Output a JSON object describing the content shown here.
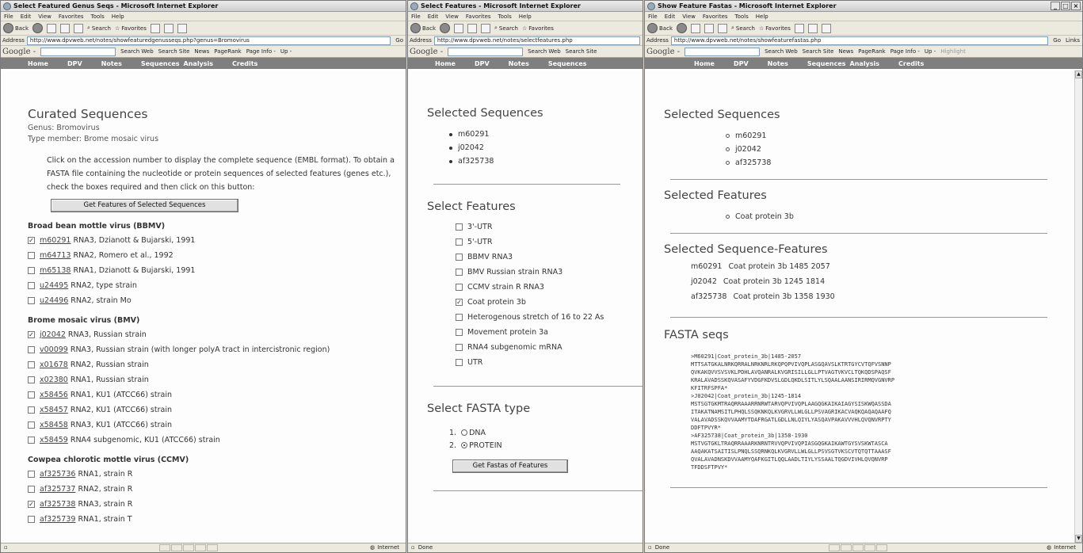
{
  "browser": {
    "menu": [
      "File",
      "Edit",
      "View",
      "Favorites",
      "Tools",
      "Help"
    ],
    "toolbar": {
      "back": "Back",
      "search": "Search",
      "favorites": "Favorites"
    },
    "address_label": "Address",
    "go_label": "Go",
    "links_label": "Links",
    "google": {
      "logo": "Google -",
      "search_web": "Search Web",
      "search_site": "Search Site",
      "news": "News",
      "pagerank": "PageRank",
      "page_info": "Page Info -",
      "up": "Up -",
      "highlight": "Highlight"
    },
    "site_nav": [
      "Home",
      "DPV",
      "Notes",
      "Sequences",
      "Analysis",
      "Credits"
    ],
    "status_done": "Done",
    "status_zone": "Internet"
  },
  "window1": {
    "title": "Select Featured Genus Seqs - Microsoft Internet Explorer",
    "url": "http://www.dpvweb.net/notes/showfeaturedgenusseqs.php?genus=Bromovirus",
    "heading": "Curated Sequences",
    "genus": "Genus: Bromovirus",
    "type_member": "Type member: Brome mosaic virus",
    "instructions": "Click on the accession number to display the complete sequence (EMBL format). To obtain a FASTA file containing the nucleotide or protein sequences of selected features (genes etc.), check the boxes required and then click on this button:",
    "button": "Get Features of Selected Sequences",
    "groups": [
      {
        "name": "Broad bean mottle virus (BBMV)",
        "rows": [
          {
            "acc": "m60291",
            "desc": "RNA3, Dzianott & Bujarski, 1991",
            "checked": true
          },
          {
            "acc": "m64713",
            "desc": "RNA2, Romero et al., 1992",
            "checked": false
          },
          {
            "acc": "m65138",
            "desc": "RNA1, Dzianott & Bujarski, 1991",
            "checked": false
          },
          {
            "acc": "u24495",
            "desc": "RNA2, type strain",
            "checked": false
          },
          {
            "acc": "u24496",
            "desc": "RNA2, strain Mo",
            "checked": false
          }
        ]
      },
      {
        "name": "Brome mosaic virus (BMV)",
        "rows": [
          {
            "acc": "j02042",
            "desc": "RNA3, Russian strain",
            "checked": true
          },
          {
            "acc": "v00099",
            "desc": "RNA3, Russian strain (with longer polyA tract in intercistronic region)",
            "checked": false
          },
          {
            "acc": "x01678",
            "desc": "RNA2, Russian strain",
            "checked": false
          },
          {
            "acc": "x02380",
            "desc": "RNA1, Russian strain",
            "checked": false
          },
          {
            "acc": "x58456",
            "desc": "RNA1, KU1 (ATCC66) strain",
            "checked": false
          },
          {
            "acc": "x58457",
            "desc": "RNA2, KU1 (ATCC66) strain",
            "checked": false
          },
          {
            "acc": "x58458",
            "desc": "RNA3, KU1 (ATCC66) strain",
            "checked": false
          },
          {
            "acc": "x58459",
            "desc": "RNA4 subgenomic, KU1 (ATCC66) strain",
            "checked": false
          }
        ]
      },
      {
        "name": "Cowpea chlorotic mottle virus (CCMV)",
        "rows": [
          {
            "acc": "af325736",
            "desc": "RNA1, strain R",
            "checked": false
          },
          {
            "acc": "af325737",
            "desc": "RNA2, strain R",
            "checked": false
          },
          {
            "acc": "af325738",
            "desc": "RNA3, strain R",
            "checked": true
          },
          {
            "acc": "af325739",
            "desc": "RNA1, strain T",
            "checked": false
          }
        ]
      }
    ]
  },
  "window2": {
    "title": "Select Features - Microsoft Internet Explorer",
    "url": "http://www.dpvweb.net/notes/selectfeatures.php",
    "selected_heading": "Selected Sequences",
    "selected": [
      "m60291",
      "j02042",
      "af325738"
    ],
    "features_heading": "Select Features",
    "features": [
      {
        "label": "3'-UTR",
        "checked": false
      },
      {
        "label": "5'-UTR",
        "checked": false
      },
      {
        "label": "BBMV RNA3",
        "checked": false
      },
      {
        "label": "BMV Russian strain RNA3",
        "checked": false
      },
      {
        "label": "CCMV strain R RNA3",
        "checked": false
      },
      {
        "label": "Coat protein 3b",
        "checked": true
      },
      {
        "label": "Heterogenous stretch of 16 to 22 As",
        "checked": false
      },
      {
        "label": "Movement protein 3a",
        "checked": false
      },
      {
        "label": "RNA4 subgenomic mRNA",
        "checked": false
      },
      {
        "label": "UTR",
        "checked": false
      }
    ],
    "fasta_heading": "Select FASTA type",
    "fasta_types": [
      {
        "num": "1.",
        "label": "DNA",
        "selected": false
      },
      {
        "num": "2.",
        "label": "PROTEIN",
        "selected": true
      }
    ],
    "button": "Get Fastas of Features"
  },
  "window3": {
    "title": "Show Feature Fastas - Microsoft Internet Explorer",
    "url": "http://www.dpvweb.net/notes/showfeaturefastas.php",
    "selected_heading": "Selected Sequences",
    "selected": [
      "m60291",
      "j02042",
      "af325738"
    ],
    "features_heading": "Selected Features",
    "features": [
      "Coat protein 3b"
    ],
    "seqfeat_heading": "Selected Sequence-Features",
    "seqfeats": [
      {
        "acc": "m60291",
        "desc": "Coat protein 3b 1485 2057"
      },
      {
        "acc": "j02042",
        "desc": "Coat protein 3b 1245 1814"
      },
      {
        "acc": "af325738",
        "desc": "Coat protein 3b 1358 1930"
      }
    ],
    "fasta_heading": "FASTA seqs",
    "fasta_text": ">M60291|Coat_protein_3b|1485-2057\nMTTSATGKALNRKQRRALNRKNRLRKQPQPVIVQPLASGQAVSLKTRTGYCVTQFVSNNP\nQVKAKQVVSVSVKLPDHLAVQANRALKVGRISILLGLLPTVAGTVKVCLTQKQDSPAQSF\nKRALAVADSSKQVASAFYVDGFKDVSLGDLQKDLSITLYLSQAALAANSIRIRMQVGNVRP\nKFITRFSPFA*\n>J02042|Coat_protein_3b|1245-1814\nMSTSGTGKMTRAQRRAAARRNRWTARVQPVIVQPLAAGQGKAIKAIAGYSISKWQASSDA\nITAKATNAMSITLPHQLSSQKNKQLKVGRVLLWLGLLPSVAGRIKACVAQKQAQAQAAFQ\nVALAVADSSKQVVAAMYTDAFRGATLGDLLNLQIYLYASQAVPAKAVVVHLQVQNVRPTY\nDDFTPVYR*\n>AF325738|Coat_protein_3b|1358-1930\nMSTVGTGKLTRAQRRAAARKNRNTRVVQPVIVQPIASGQGKAIKAWTGYSVSKWTASCA\nAAQAKATSAITISLPNQLSSQRNKQLKVGRVLLWLGLLPSVSGTVKSCVTQTQTTAAASF\nQVALAVADNSKDVVAAMYQAFKGITLQQLAADLTIYLYSSAALTQGDVIVHLQVQNVRP\nTFDDSFTPVY*"
  }
}
